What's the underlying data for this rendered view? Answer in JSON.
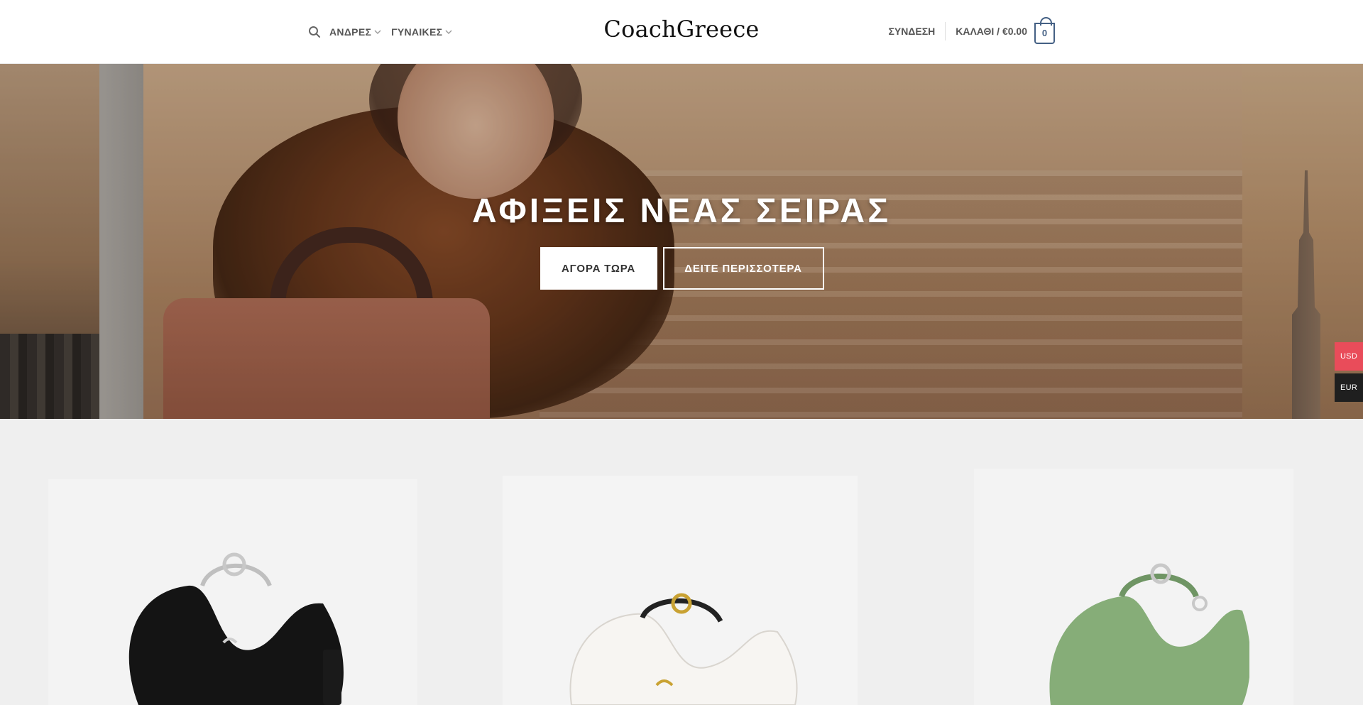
{
  "header": {
    "nav": [
      {
        "label": "ΑΝΔΡΕΣ"
      },
      {
        "label": "ΓΥΝΑΙΚΕΣ"
      }
    ],
    "logo": "CoachGreece",
    "login": "ΣΥΝΔΕΣΗ",
    "cart_label": "ΚΑΛΑΘΙ / €0.00",
    "cart_count": "0"
  },
  "hero": {
    "title": "ΑΦΙΞΕΙΣ ΝΕΑΣ ΣΕΙΡΑΣ",
    "primary_button": "ΑΓΟΡΑ ΤΩΡΑ",
    "secondary_button": "ΔΕΙΤΕ ΠΕΡΙΣΣΟΤΕΡΑ"
  },
  "currency": {
    "usd": "USD",
    "eur": "EUR"
  },
  "products": [
    {
      "icon": "black-handbag-image",
      "color": "#111111"
    },
    {
      "icon": "white-handbag-image",
      "color": "#f4f1ee"
    },
    {
      "icon": "green-handbag-image",
      "color": "#7fa673"
    }
  ]
}
